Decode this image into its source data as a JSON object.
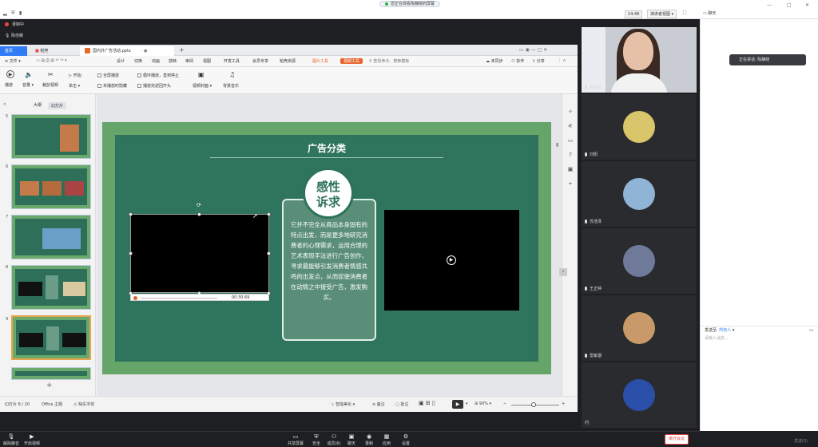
{
  "os": {
    "share_notice": "您正在观看陈静晓的屏幕",
    "time": "14:46",
    "layout_label": "演讲者视图",
    "chat_label": "聊天"
  },
  "recording": {
    "status": "录制中",
    "speaker": "陈佳薇"
  },
  "wps": {
    "tabs": {
      "home": "首页",
      "docer": "稻壳",
      "file": "国内外广告活动.pptx"
    },
    "menu": [
      "文件",
      "设计",
      "切换",
      "动画",
      "放映",
      "审阅",
      "视图",
      "开发工具",
      "会员专享",
      "稻壳资源",
      "图片工具",
      "视频工具"
    ],
    "search_placeholder": "查找命令、搜索模板",
    "right_actions": [
      "未同步",
      "协作",
      "分享"
    ],
    "toolbar": {
      "play": "播放",
      "volume": "音量",
      "trim": "裁剪视频",
      "start": "开始:",
      "start_val": "单击",
      "fullscreen": "全屏播放",
      "loop": "循环播放，直到停止",
      "hide": "未播放时隐藏",
      "rewind": "播放完返回开头",
      "cover": "视频封面",
      "bg_music": "背景音乐"
    },
    "pane_tabs": {
      "outline": "大纲",
      "slides": "幻灯片"
    },
    "thumb_numbers": [
      "5",
      "6",
      "7",
      "8",
      "9"
    ],
    "slide": {
      "title": "广告分类",
      "badge_line1": "感性",
      "badge_line2": "诉求",
      "body": "它并不完全从商品本身固有的特点出发，而是更多地研究消费者的心理需求，运用合理的艺术表现手法进行广告创作，寻求最能够引发消费者情感共鸣的出发点，从而促使消费者在动情之中接受广告，激发购买。",
      "video_time": "00:30.69"
    },
    "status": {
      "slide_info": "幻灯片 8 / 20",
      "theme": "Office 主题",
      "missing_font": "缺失字体",
      "beautify": "智能美化",
      "notes": "备注",
      "comments": "批注",
      "zoom": "90%"
    }
  },
  "participants": [
    {
      "name": "陈静晓",
      "kind": "camera"
    },
    {
      "name": "刘阳",
      "kind": "avatar",
      "color": "#d9c56a"
    },
    {
      "name": "苏浩泽",
      "kind": "avatar",
      "color": "#8fb4d6"
    },
    {
      "name": "王正钟",
      "kind": "avatar",
      "color": "#6f7a9a"
    },
    {
      "name": "雷紫烟",
      "kind": "avatar",
      "color": "#c89a6a"
    },
    {
      "name": "问",
      "kind": "avatar",
      "color": "#2a4fa8"
    }
  ],
  "chat": {
    "speaking": "正在讲话: 陈静晓",
    "send_to_label": "发送至:",
    "send_to_value": "所有人",
    "input_placeholder": "请输入消息...",
    "send": "发送(S)"
  },
  "meetbar": {
    "mute": "解除静音",
    "video": "开启视频",
    "share": "共享屏幕",
    "security": "安全",
    "members": "成员(6)",
    "chat": "聊天",
    "record": "录制",
    "apps": "应用",
    "settings": "设置",
    "leave": "离开会议"
  }
}
